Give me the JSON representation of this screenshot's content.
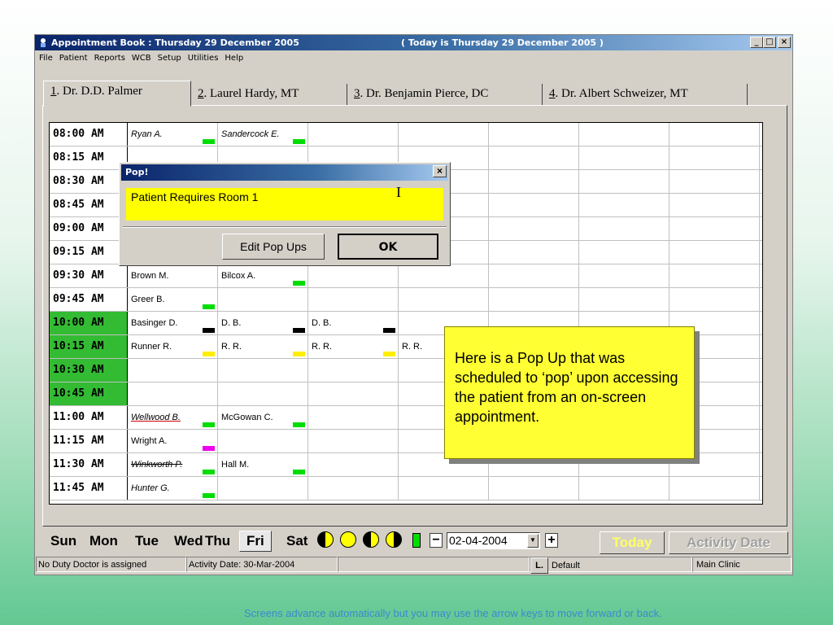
{
  "window": {
    "title": "Appointment Book : Thursday 29 December 2005",
    "today": "( Today is Thursday 29 December 2005 )",
    "minimize": "_",
    "maximize": "□",
    "close": "×"
  },
  "menu": [
    "File",
    "Patient",
    "Reports",
    "WCB",
    "Setup",
    "Utilities",
    "Help"
  ],
  "tabs": [
    {
      "num": "1",
      "label": ". Dr. D.D. Palmer"
    },
    {
      "num": "2",
      "label": ". Laurel Hardy, MT"
    },
    {
      "num": "3",
      "label": ". Dr. Benjamin Pierce, DC"
    },
    {
      "num": "4",
      "label": ". Dr. Albert Schweizer, MT"
    }
  ],
  "schedule": [
    {
      "time": "08:00 AM",
      "green": false,
      "cells": [
        {
          "name": "Ryan A.",
          "style": "italic",
          "mark": "#00dd00"
        },
        {
          "name": "Sandercock E.",
          "style": "italic",
          "mark": "#00dd00"
        }
      ]
    },
    {
      "time": "08:15 AM",
      "green": false,
      "cells": []
    },
    {
      "time": "08:30 AM",
      "green": false,
      "cells": []
    },
    {
      "time": "08:45 AM",
      "green": false,
      "cells": []
    },
    {
      "time": "09:00 AM",
      "green": false,
      "cells": []
    },
    {
      "time": "09:15 AM",
      "green": false,
      "cells": []
    },
    {
      "time": "09:30 AM",
      "green": false,
      "cells": [
        {
          "name": "Brown M.",
          "style": "",
          "mark": ""
        },
        {
          "name": "Bilcox A.",
          "style": "",
          "mark": "#00dd00"
        }
      ]
    },
    {
      "time": "09:45 AM",
      "green": false,
      "cells": [
        {
          "name": "Greer B.",
          "style": "",
          "mark": "#00dd00"
        }
      ]
    },
    {
      "time": "10:00 AM",
      "green": true,
      "cells": [
        {
          "name": "Basinger D.",
          "style": "",
          "mark": "#000000"
        },
        {
          "name": "D. B.",
          "style": "",
          "mark": "#000000"
        },
        {
          "name": "D. B.",
          "style": "",
          "mark": "#000000"
        }
      ]
    },
    {
      "time": "10:15 AM",
      "green": true,
      "cells": [
        {
          "name": "Runner R.",
          "style": "",
          "mark": "#ffee00"
        },
        {
          "name": "R. R.",
          "style": "",
          "mark": "#ffee00"
        },
        {
          "name": "R. R.",
          "style": "",
          "mark": "#ffee00"
        },
        {
          "name": "R. R.",
          "style": "",
          "mark": ""
        }
      ]
    },
    {
      "time": "10:30 AM",
      "green": true,
      "cells": []
    },
    {
      "time": "10:45 AM",
      "green": true,
      "cells": []
    },
    {
      "time": "11:00 AM",
      "green": false,
      "cells": [
        {
          "name": "Wellwood B.",
          "style": "italic red-underline",
          "mark": "#00dd00"
        },
        {
          "name": "McGowan C.",
          "style": "",
          "mark": "#00dd00"
        }
      ]
    },
    {
      "time": "11:15 AM",
      "green": false,
      "cells": [
        {
          "name": "Wright A.",
          "style": "",
          "mark": "#ee00ee"
        }
      ]
    },
    {
      "time": "11:30 AM",
      "green": false,
      "cells": [
        {
          "name": "Winkworth P.",
          "style": "italic strike",
          "mark": "#00dd00"
        },
        {
          "name": "Hall M.",
          "style": "",
          "mark": "#00dd00"
        }
      ]
    },
    {
      "time": "11:45 AM",
      "green": false,
      "cells": [
        {
          "name": "Hunter G.",
          "style": "italic",
          "mark": "#00dd00"
        }
      ]
    }
  ],
  "popup": {
    "title": "Pop!",
    "close": "×",
    "message": "Patient Requires Room 1",
    "edit_label": "Edit Pop Ups",
    "ok_label": "OK"
  },
  "callout": "Here is a Pop Up that was scheduled to ‘pop’ upon accessing the patient from an on-screen appointment.",
  "days": {
    "sun": "Sun",
    "mon": "Mon",
    "tue": "Tue",
    "wed": "Wed",
    "thu": "Thu",
    "fri": "Fri",
    "sat": "Sat"
  },
  "nav": {
    "minus": "−",
    "plus": "+",
    "date": "02-04-2004",
    "today_label": "Today",
    "activity_label": "Activity Date"
  },
  "status": {
    "duty": "No Duty Doctor is assigned",
    "activity": "Activity Date: 30-Mar-2004",
    "l_badge": "L.",
    "default": "Default",
    "clinic": "Main Clinic"
  },
  "footer": "Screens advance automatically but you may use the arrow keys to move forward or back.",
  "colors": {
    "green_time": "#33bb33",
    "popup_bg": "#ffff00",
    "callout_bg": "#ffff33"
  }
}
